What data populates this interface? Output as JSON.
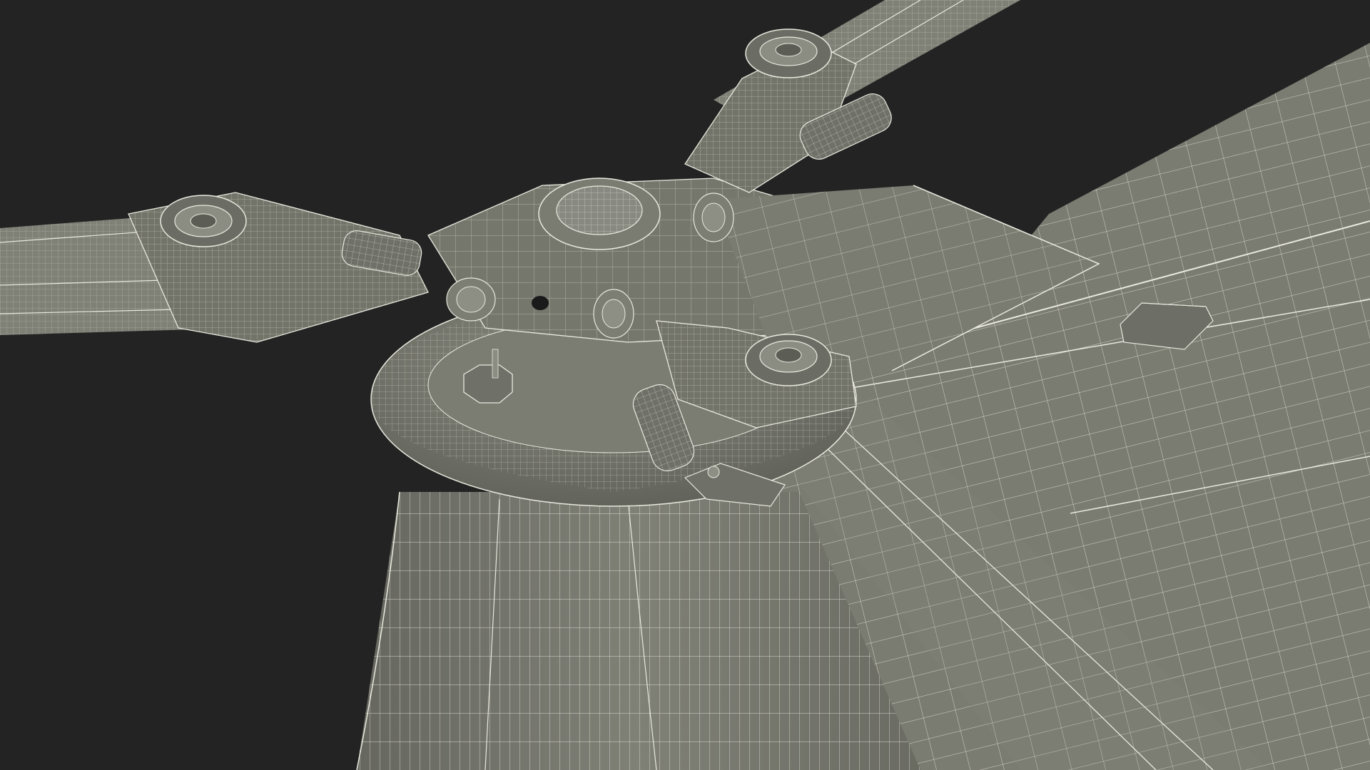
{
  "scene": {
    "subject": "helicopter-main-rotor-hub-wireframe",
    "render_style": "wireframe-over-shaded",
    "colors": {
      "background": "#232323",
      "surface": "#7b7c72",
      "surface_light": "#8a8b80",
      "surface_dark": "#5f6058",
      "wire": "#e9e9df",
      "hole": "#1a1a1a"
    },
    "blade_count": 3
  }
}
